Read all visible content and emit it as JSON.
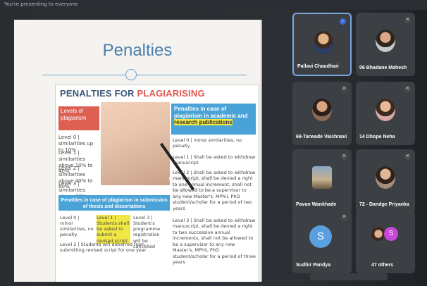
{
  "topbar": {
    "text": "You're presenting to everyone"
  },
  "slide": {
    "title": "Penalties",
    "heading_prefix": "PENALTIES FOR ",
    "heading_accent": "PLAGIARISING",
    "levels_header": "Levels of plagiarism",
    "levels": [
      "Level 0 | similarities up to 10%",
      "Level 1 | similarities above 10% to 40%",
      "Level 2 | similarities above 40% to 60%",
      "Level 3 | similarities above 60%"
    ],
    "blue_box_text": "Penalties in case of plagiarism in academic and ",
    "blue_box_highlight": "research publications",
    "right_items": [
      "Level 0 | minor similarities, no penalty",
      "Level 1 | Shall be asked to withdraw manuscript",
      "Level 2 | Shall be asked to withdraw manuscript, shall be denied a right to one annual increment, shall not be allowed to be a supervisor to any new Master's, MPhil, PhD student/scholar for a period of two years",
      "Level 3 | Shall be asked to withdraw manuscript, shall be denied a right to two successive annual increments, shall not be allowed to be a supervisor to any new Master's, MPhil, PhD student/scholar for a period of three years"
    ],
    "bottom_banner": "Penalties in case of plagiarism in submission of thesis and dissertations",
    "bottom_cells": [
      "Level 0 | minor similarities, no penalty",
      "Level 1 | Students shall be asked to submit a revised script",
      "Level 3 | Student's programme registration will be cancelled",
      "Level 2 | Students will debarred from submitting revised script for one year"
    ]
  },
  "participants": [
    {
      "name": "Pallavi Chaudhari",
      "speaking": true,
      "avatar": "photo"
    },
    {
      "name": "06 Bhadane Mahesh",
      "speaking": false,
      "avatar": "photo"
    },
    {
      "name": "69-Tarwade Vaishnavi",
      "speaking": false,
      "avatar": "photo"
    },
    {
      "name": "14 Dhope Neha",
      "speaking": false,
      "avatar": "photo"
    },
    {
      "name": "Pavan Wankhade",
      "speaking": false,
      "avatar": "photo"
    },
    {
      "name": "72 - Dandge Priyanka",
      "speaking": false,
      "avatar": "photo"
    },
    {
      "name": "Sudhir Pandya",
      "speaking": false,
      "avatar": "S"
    },
    {
      "name": "47 others",
      "speaking": false,
      "avatar": "S"
    }
  ]
}
